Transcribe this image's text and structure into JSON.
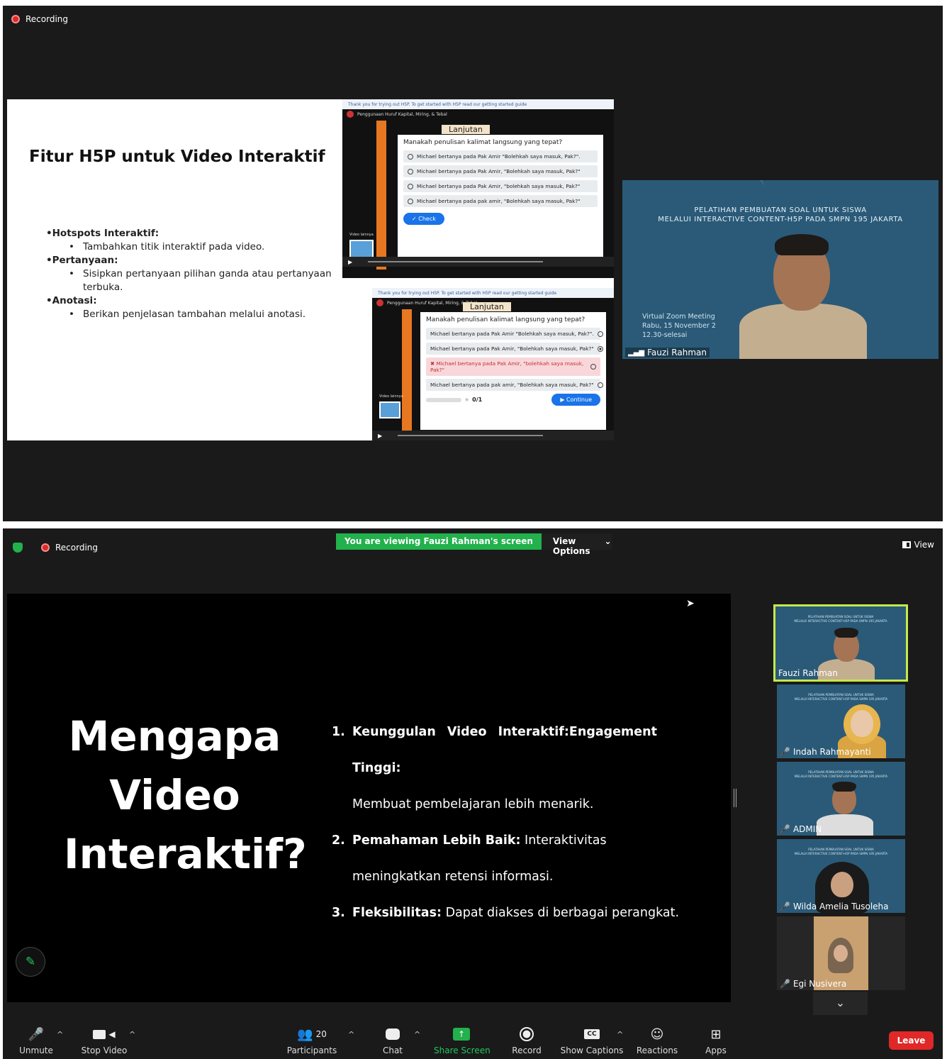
{
  "top": {
    "recording_label": "Recording",
    "slide": {
      "title": "Fitur H5P untuk Video Interaktif",
      "bullets": [
        {
          "head": "•Hotspots Interaktif:",
          "sub": "Tambahkan titik interaktif pada video."
        },
        {
          "head": "•Pertanyaan:",
          "sub": "Sisipkan pertanyaan pilihan ganda atau pertanyaan terbuka."
        },
        {
          "head": "•Anotasi:",
          "sub": "Berikan penjelasan tambahan melalui anotasi."
        }
      ],
      "h5p_a": {
        "top_notice": "Thank you for trying out H5P. To get started with H5P read our getting started guide",
        "brand": "Penggunaan Huruf Kapital, Miring, & Tebal",
        "overlay_title": "Lanjutan",
        "question": "Manakah penulisan kalimat langsung yang tepat?",
        "options": [
          "Michael bertanya pada Pak Amir \"Bolehkah saya masuk, Pak?\".",
          "Michael bertanya pada Pak Amir, \"Bolehkah saya masuk, Pak?\"",
          "Michael bertanya pada Pak Amir, \"bolehkah saya masuk, Pak?\"",
          "Michael bertanya pada pak amir, \"Bolehkah saya masuk, Pak?\""
        ],
        "check_label": "Check",
        "video_label": "Video lainnya"
      },
      "h5p_b": {
        "top_notice": "Thank you for trying out H5P. To get started with H5P read our getting started guide",
        "brand": "Penggunaan Huruf Kapital, Miring, & Tebal",
        "overlay_title": "Lanjutan",
        "question": "Manakah penulisan kalimat langsung yang tepat?",
        "options": [
          "Michael bertanya pada Pak Amir \"Bolehkah saya masuk, Pak?\".",
          "Michael bertanya pada Pak Amir, \"Bolehkah saya masuk, Pak?\"",
          "Michael bertanya pada Pak Amir, \"bolehkah saya masuk, Pak?\"",
          "Michael bertanya pada pak amir, \"Bolehkah saya masuk, Pak?\""
        ],
        "score": "0/1",
        "continue_label": "Continue",
        "video_label": "Video lainnya"
      }
    },
    "speaker_tile": {
      "title_line1": "PELATIHAN PEMBUATAN SOAL UNTUK SISWA",
      "title_line2": "MELALUI INTERACTIVE CONTENT-H5P PADA SMPN 195 JAKARTA",
      "info_line1": "Virtual Zoom Meeting",
      "info_line2": "Rabu, 15 November 2",
      "info_line3": "12.30-selesai",
      "name": "Fauzi Rahman"
    }
  },
  "bottom": {
    "recording_label": "Recording",
    "banner_text": "You are viewing Fauzi Rahman's screen",
    "view_options_label": "View Options",
    "view_label": "View",
    "slide": {
      "title_line1": "Mengapa",
      "title_line2": "Video",
      "title_line3": "Interaktif?",
      "items": [
        {
          "num": "1.",
          "bold": "Keunggulan Video Interaktif:Engagement Tinggi:",
          "text": "Membuat pembelajaran lebih menarik."
        },
        {
          "num": "2.",
          "bold": "Pemahaman Lebih Baik:",
          "text": " Interaktivitas meningkatkan retensi informasi."
        },
        {
          "num": "3.",
          "bold": "Fleksibilitas:",
          "text": " Dapat diakses di berbagai perangkat."
        }
      ]
    },
    "participants": [
      {
        "name": "Fauzi Rahman",
        "muted": false,
        "active": true
      },
      {
        "name": "Indah Rahmayanti",
        "muted": true,
        "active": false
      },
      {
        "name": "ADMIN",
        "muted": true,
        "active": false
      },
      {
        "name": "Wilda Amelia Tusoleha",
        "muted": true,
        "active": false
      },
      {
        "name": "Egi Nusivera",
        "muted": true,
        "active": false
      }
    ],
    "toolbar": {
      "unmute": "Unmute",
      "stop_video": "Stop Video",
      "participants": "Participants",
      "participants_count": "20",
      "chat": "Chat",
      "share_screen": "Share Screen",
      "record": "Record",
      "show_captions": "Show Captions",
      "reactions": "Reactions",
      "apps": "Apps",
      "leave": "Leave"
    }
  },
  "colors": {
    "zoom_green": "#22b14c",
    "leave_red": "#e02828",
    "tile_blue": "#2a5a78",
    "active_border": "#c6e94a"
  }
}
